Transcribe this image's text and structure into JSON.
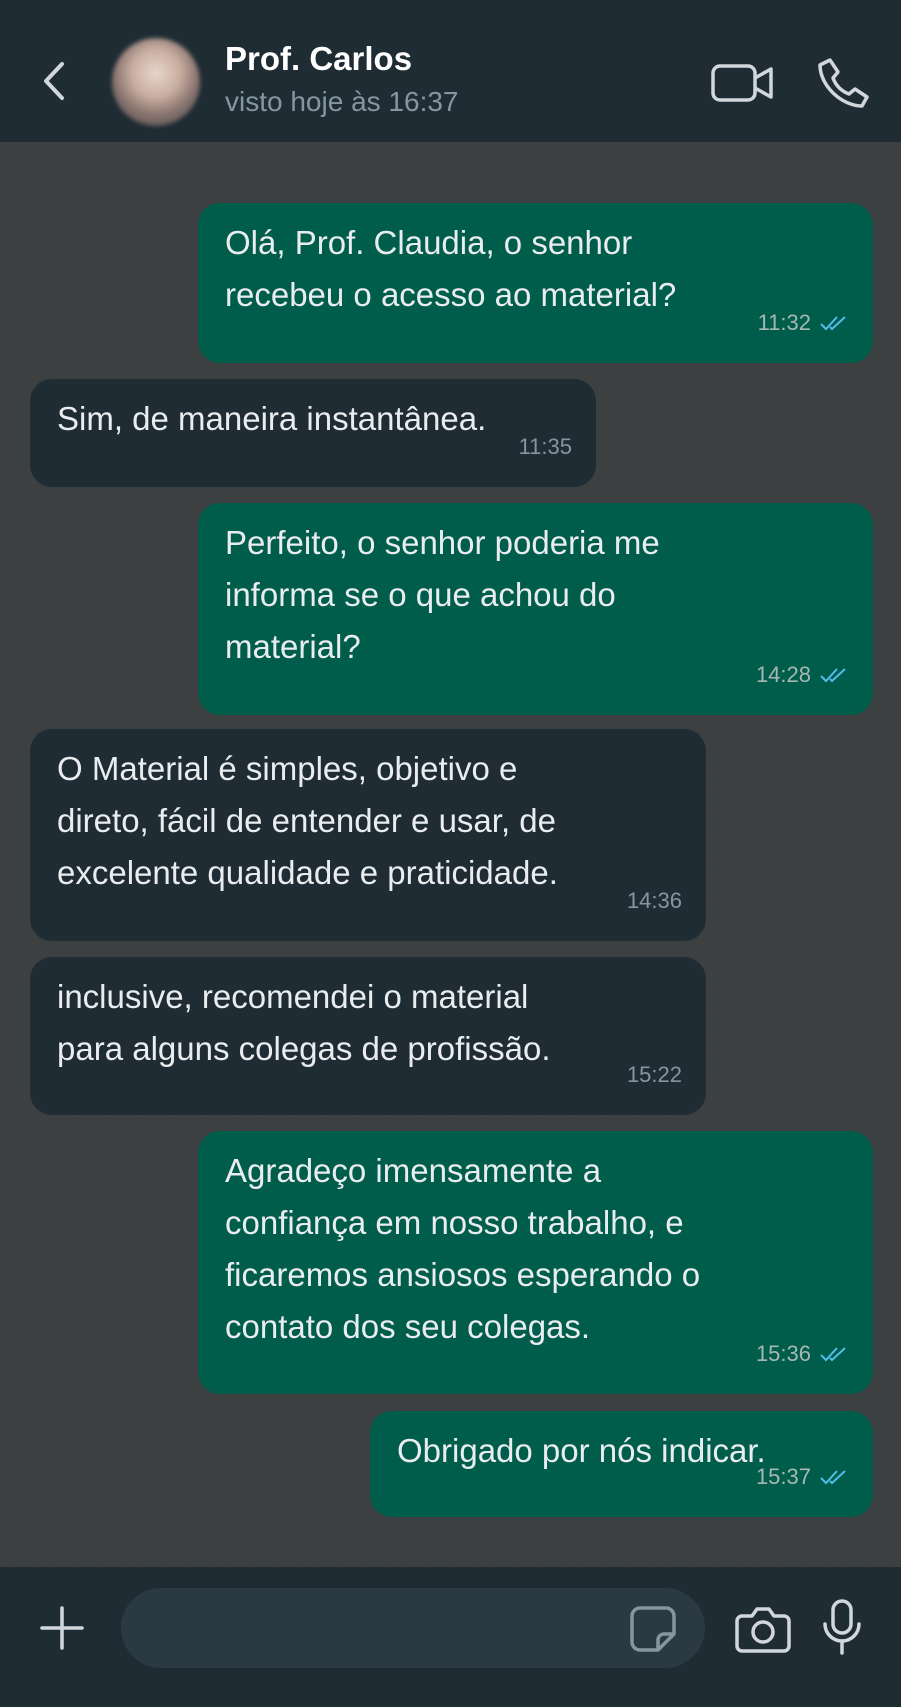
{
  "header": {
    "contact_name": "Prof. Carlos",
    "status": "visto hoje às 16:37",
    "back_icon": "chevron-left-icon",
    "video_icon": "video-camera-icon",
    "call_icon": "phone-icon"
  },
  "colors": {
    "header_bg": "#1f2c34",
    "chat_bg": "#3d4040",
    "outgoing_bubble": "#005c4b",
    "incoming_bubble": "#1f2c34",
    "read_ticks": "#53bdeb"
  },
  "messages": [
    {
      "direction": "out",
      "text": "Olá, Prof. Claudia, o senhor\nrecebeu o acesso ao material?",
      "time": "11:32",
      "read": true
    },
    {
      "direction": "in",
      "text": "Sim, de maneira instantânea.",
      "time": "11:35"
    },
    {
      "direction": "out",
      "text": "Perfeito, o senhor poderia me\ninforma se o que achou do\nmaterial?",
      "time": "14:28",
      "read": true
    },
    {
      "direction": "in",
      "text": "O Material é simples, objetivo e\ndireto, fácil de entender e usar, de\nexcelente qualidade e praticidade.",
      "time": "14:36"
    },
    {
      "direction": "in",
      "text": "inclusive, recomendei o material\npara alguns colegas de profissão.",
      "time": "15:22"
    },
    {
      "direction": "out",
      "text": "Agradeço imensamente a\nconfiança em nosso trabalho, e\nficaremos ansiosos esperando o\ncontato dos seu colegas.",
      "time": "15:36",
      "read": true
    },
    {
      "direction": "out",
      "text": "Obrigado por nós indicar.",
      "time": "15:37",
      "read": true
    }
  ],
  "composer": {
    "placeholder": "",
    "plus_icon": "plus-icon",
    "sticker_icon": "sticker-icon",
    "camera_icon": "camera-icon",
    "mic_icon": "microphone-icon"
  }
}
